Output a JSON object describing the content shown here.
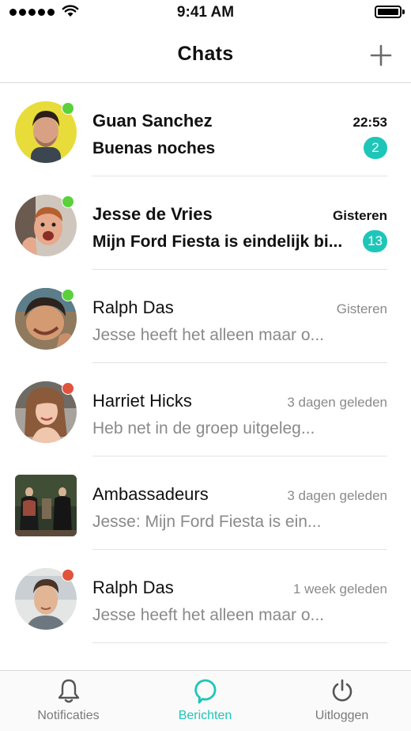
{
  "status_bar": {
    "time": "9:41 AM"
  },
  "nav": {
    "title": "Chats",
    "add_icon": "plus-icon"
  },
  "colors": {
    "accent": "#1ec6b8",
    "online": "#5ad13c",
    "busy": "#e0533d"
  },
  "chats": [
    {
      "name": "Guan Sanchez",
      "time": "22:53",
      "preview": "Buenas noches",
      "unread": "2",
      "status": "online",
      "bold": true
    },
    {
      "name": "Jesse de Vries",
      "time": "Gisteren",
      "preview": "Mijn Ford Fiesta is eindelijk bi...",
      "unread": "13",
      "status": "online",
      "bold": true
    },
    {
      "name": "Ralph Das",
      "time": "Gisteren",
      "preview": "Jesse heeft het alleen maar o...",
      "unread": "",
      "status": "online",
      "bold": false
    },
    {
      "name": "Harriet Hicks",
      "time": "3 dagen geleden",
      "preview": "Heb net in de groep uitgeleg...",
      "unread": "",
      "status": "busy",
      "bold": false
    },
    {
      "name": "Ambassadeurs",
      "time": "3 dagen geleden",
      "preview": "Jesse: Mijn Ford Fiesta is ein...",
      "unread": "",
      "status": "none",
      "bold": false
    },
    {
      "name": "Ralph Das",
      "time": "1 week geleden",
      "preview": "Jesse heeft het alleen maar o...",
      "unread": "",
      "status": "busy",
      "bold": false
    }
  ],
  "tabs": [
    {
      "label": "Notificaties",
      "icon": "bell-icon",
      "active": false
    },
    {
      "label": "Berichten",
      "icon": "chat-bubble-icon",
      "active": true
    },
    {
      "label": "Uitloggen",
      "icon": "power-icon",
      "active": false
    }
  ]
}
